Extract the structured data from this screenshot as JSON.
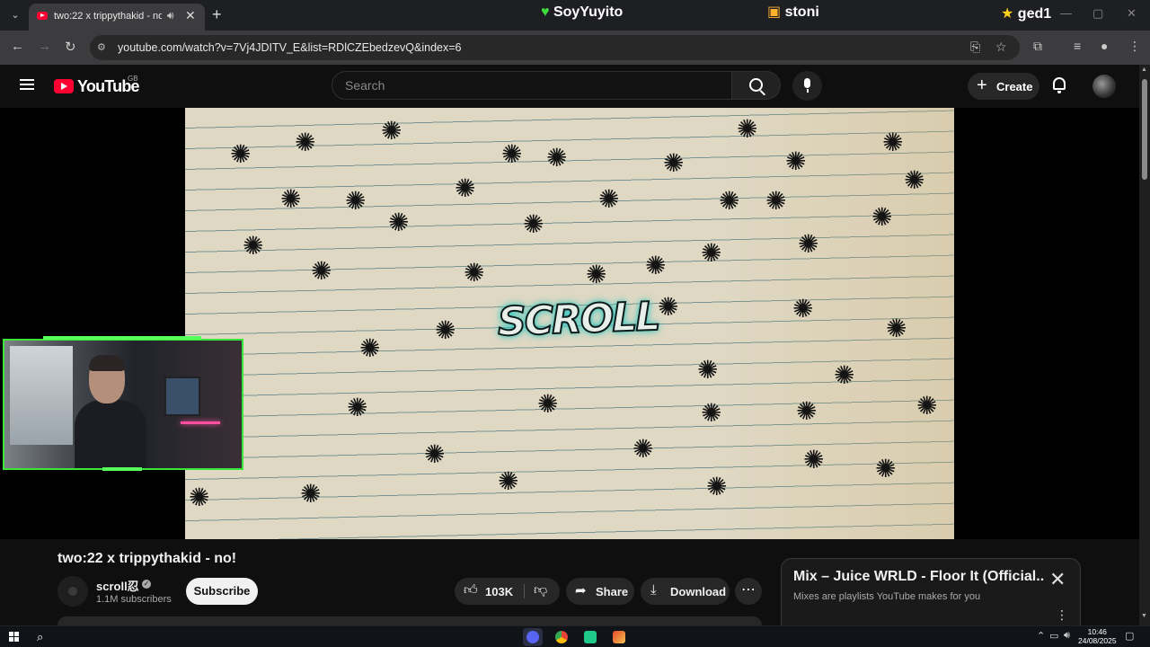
{
  "browser": {
    "tab": {
      "title": "two:22 x trippythakid - no!"
    },
    "overlay_names": [
      "SoyYuyito",
      "stoni",
      "ged1"
    ],
    "url": "youtube.com/watch?v=7Vj4JDITV_E&list=RDlCZEbedzevQ&index=6"
  },
  "youtube": {
    "logo_text": "YouTube",
    "region": "GB",
    "search_placeholder": "Search",
    "create_label": "Create"
  },
  "video": {
    "graffiti_text": "SCROLL",
    "title": "two:22 x trippythakid - no!",
    "channel": {
      "name": "scroll忍",
      "subscribers": "1.1M subscribers",
      "subscribe_label": "Subscribe"
    },
    "actions": {
      "likes": "103K",
      "share_label": "Share",
      "download_label": "Download"
    }
  },
  "mix_panel": {
    "title": "Mix – Juice WRLD - Floor It (Official...",
    "subtitle": "Mixes are playlists YouTube makes for you"
  },
  "taskbar": {
    "time": "10:46",
    "date": "24/08/2025"
  },
  "colors": {
    "yt_red": "#ff0033",
    "webcam_border": "#39e639",
    "graffiti_glow": "#32c8c0",
    "paper": "#dfd8c3"
  }
}
